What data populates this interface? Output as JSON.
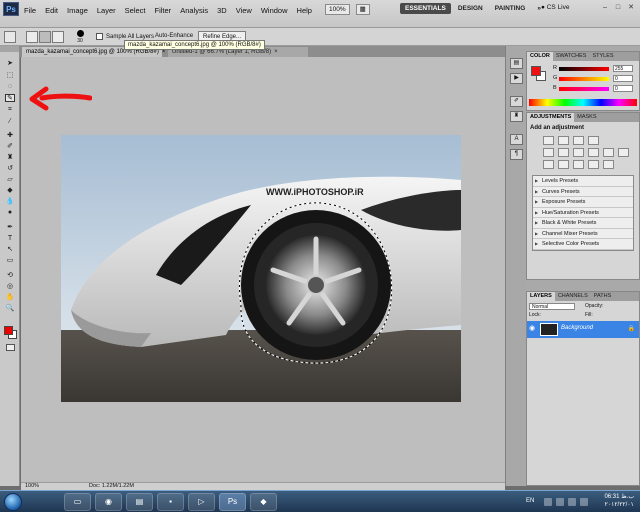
{
  "menu": {
    "logo": "Ps",
    "items": [
      "File",
      "Edit",
      "Image",
      "Layer",
      "Select",
      "Filter",
      "Analysis",
      "3D",
      "View",
      "Window",
      "Help"
    ],
    "zoom": "100%",
    "workspaces": [
      "ESSENTIALS",
      "DESIGN",
      "PAINTING"
    ],
    "more": "»",
    "cs_live": "CS Live"
  },
  "options": {
    "brush_size": "30",
    "sample_all_layers": "Sample All Layers",
    "auto_enhance": "Auto-Enhance",
    "refine_edge": "Refine Edge..."
  },
  "tabs": {
    "active": "mazda_kazamai_concept6.jpg @ 100% (RGB/8#)",
    "inactive": "Untitled-1 @ 66.7% (Layer 1, RGB/8)",
    "close": "×"
  },
  "tooltip": "mazda_kazamai_concept6.jpg @ 100% (RGB/8#)",
  "watermark": "WWW.iPHOTOSHOP.iR",
  "status": {
    "zoom": "100%",
    "doc": "Doc: 1.22M/1.22M"
  },
  "color_panel": {
    "tabs": [
      "COLOR",
      "SWATCHES",
      "STYLES"
    ],
    "r_label": "R",
    "g_label": "G",
    "b_label": "B",
    "r": "255",
    "g": "0",
    "b": "0",
    "fg_color": "#ee1111"
  },
  "adjustments": {
    "tabs": [
      "ADJUSTMENTS",
      "MASKS"
    ],
    "title": "Add an adjustment",
    "presets": [
      "Levels Presets",
      "Curves Presets",
      "Exposure Presets",
      "Hue/Saturation Presets",
      "Black & White Presets",
      "Channel Mixer Presets",
      "Selective Color Presets"
    ]
  },
  "layers": {
    "tabs": [
      "LAYERS",
      "CHANNELS",
      "PATHS"
    ],
    "blend_mode": "Normal",
    "opacity_label": "Opacity:",
    "lock_label": "Lock:",
    "fill_label": "Fill:",
    "layer_name": "Background"
  },
  "taskbar": {
    "lang": "EN",
    "time": "06:31 ب.ظ",
    "date": "۲۰۱۲/۲۲/۰۱",
    "ps_label": "Ps"
  }
}
